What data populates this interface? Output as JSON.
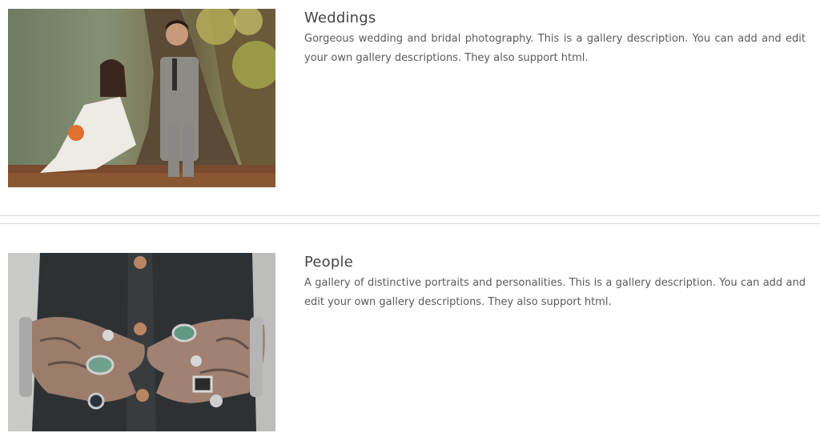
{
  "galleries": [
    {
      "title": "Weddings",
      "description": "Gorgeous wedding and bridal photography. This is a gallery description. You can add and edit your own gallery descriptions. They also support html.",
      "image": "wedding-couple-photo"
    },
    {
      "title": "People",
      "description": "A gallery of distinctive portraits and personalities. This is a gallery description. You can add and edit your own gallery descriptions. They also support html.",
      "image": "tattooed-hands-rings-photo"
    }
  ]
}
